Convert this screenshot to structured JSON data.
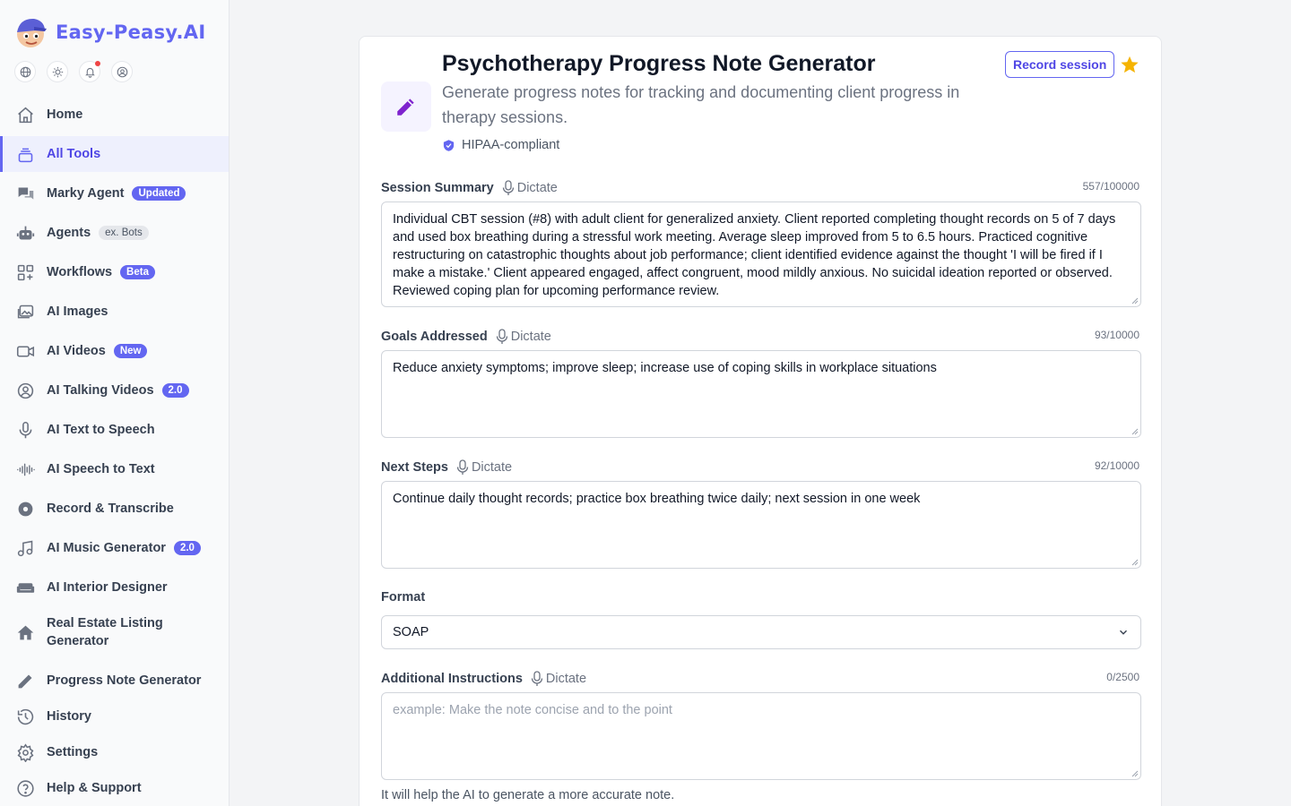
{
  "brand": {
    "name": "Easy-Peasy.AI"
  },
  "sidebar": {
    "items": [
      {
        "label": "Home",
        "icon": "home-icon"
      },
      {
        "label": "All Tools",
        "icon": "layers-icon",
        "active": true
      },
      {
        "label": "Marky Agent",
        "icon": "chat-icon",
        "badge": "Updated"
      },
      {
        "label": "Agents",
        "icon": "robot-icon",
        "badge": "ex. Bots"
      },
      {
        "label": "Workflows",
        "icon": "workflow-icon",
        "badge": "Beta"
      },
      {
        "label": "AI Images",
        "icon": "image-icon"
      },
      {
        "label": "AI Videos",
        "icon": "video-icon",
        "badge": "New"
      },
      {
        "label": "AI Talking Videos",
        "icon": "avatar-icon",
        "badge": "2.0"
      },
      {
        "label": "AI Text to Speech",
        "icon": "microphone-icon"
      },
      {
        "label": "AI Speech to Text",
        "icon": "waveform-icon"
      },
      {
        "label": "Record & Transcribe",
        "icon": "record-icon"
      },
      {
        "label": "AI Music Generator",
        "icon": "music-icon",
        "badge": "2.0"
      },
      {
        "label": "AI Interior Designer",
        "icon": "sofa-icon"
      },
      {
        "label": "Real Estate Listing Generator",
        "icon": "house-icon"
      },
      {
        "label": "Progress Note Generator",
        "icon": "pencil-icon"
      },
      {
        "label": "History",
        "icon": "history-icon"
      },
      {
        "label": "Settings",
        "icon": "gear-icon"
      },
      {
        "label": "Help & Support",
        "icon": "help-icon"
      }
    ]
  },
  "tool": {
    "title": "Psychotherapy Progress Note Generator",
    "subtitle": "Generate progress notes for tracking and documenting client progress in therapy sessions.",
    "hipaa": "HIPAA-compliant",
    "record_button": "Record session"
  },
  "form": {
    "dictate_label": "Dictate",
    "session_summary": {
      "label": "Session Summary",
      "counter": "557/100000",
      "value": "Individual CBT session (#8) with adult client for generalized anxiety. Client reported completing thought records on 5 of 7 days and used box breathing during a stressful work meeting. Average sleep improved from 5 to 6.5 hours. Practiced cognitive restructuring on catastrophic thoughts about job performance; client identified evidence against the thought 'I will be fired if I make a mistake.' Client appeared engaged, affect congruent, mood mildly anxious. No suicidal ideation reported or observed. Reviewed coping plan for upcoming performance review."
    },
    "goals": {
      "label": "Goals Addressed",
      "counter": "93/10000",
      "value": "Reduce anxiety symptoms; improve sleep; increase use of coping skills in workplace situations"
    },
    "next_steps": {
      "label": "Next Steps",
      "counter": "92/10000",
      "value": "Continue daily thought records; practice box breathing twice daily; next session in one week"
    },
    "format": {
      "label": "Format",
      "value": "SOAP"
    },
    "additional": {
      "label": "Additional Instructions",
      "counter": "0/2500",
      "placeholder": "example: Make the note concise and to the point",
      "helper": "It will help the AI to generate a more accurate note."
    }
  },
  "colors": {
    "accent": "#6366f1",
    "star": "#f5b301",
    "notification": "#ef4444"
  }
}
